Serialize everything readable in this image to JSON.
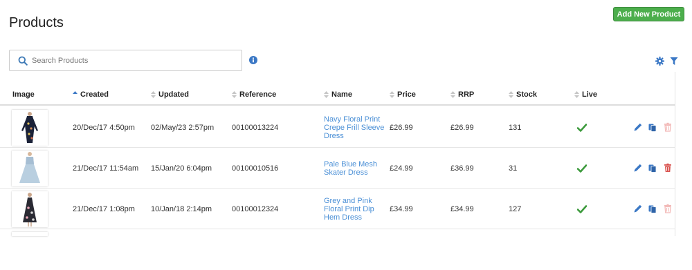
{
  "page": {
    "title": "Products"
  },
  "toolbar": {
    "add_label": "Add New Product"
  },
  "search": {
    "placeholder": "Search Products",
    "value": ""
  },
  "table": {
    "columns": [
      "Image",
      "Created",
      "Updated",
      "Reference",
      "Name",
      "Price",
      "RRP",
      "Stock",
      "Live"
    ],
    "rows": [
      {
        "created": "20/Dec/17 4:50pm",
        "updated": "02/May/23 2:57pm",
        "reference": "00100013224",
        "name_lines": [
          "Navy Floral Print",
          "Crepe Frill Sleeve",
          "Dress"
        ],
        "price": "£26.99",
        "rrp": "£26.99",
        "stock": "131",
        "live": true,
        "delete_enabled": false
      },
      {
        "created": "21/Dec/17 11:54am",
        "updated": "15/Jan/20 6:04pm",
        "reference": "00100010516",
        "name_lines": [
          "Pale Blue Mesh",
          "Skater Dress"
        ],
        "price": "£24.99",
        "rrp": "£36.99",
        "stock": "31",
        "live": true,
        "delete_enabled": true
      },
      {
        "created": "21/Dec/17 1:08pm",
        "updated": "10/Jan/18 2:14pm",
        "reference": "00100012324",
        "name_lines": [
          "Grey and Pink",
          "Floral Print Dip",
          "Hem Dress"
        ],
        "price": "£34.99",
        "rrp": "£34.99",
        "stock": "127",
        "live": true,
        "delete_enabled": false
      }
    ]
  },
  "icons": [
    "search-icon",
    "info-icon",
    "gear-icon",
    "filter-icon",
    "sort-icon",
    "checkmark-icon",
    "edit-icon",
    "copy-icon",
    "trash-icon"
  ],
  "colors": {
    "accent": "#4a8fd6",
    "success": "#4cae4c",
    "danger": "#d9534f",
    "danger_disabled": "#f2b8b6"
  }
}
